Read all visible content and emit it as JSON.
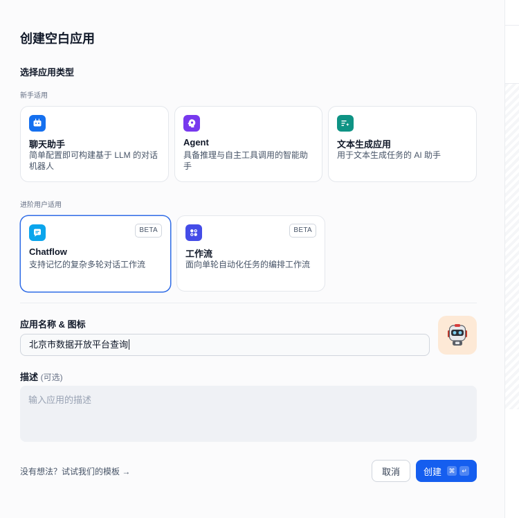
{
  "dialog": {
    "title": "创建空白应用",
    "app_type_title": "选择应用类型",
    "beginner_label": "新手适用",
    "advanced_label": "进阶用户适用"
  },
  "app_types": {
    "beginner": [
      {
        "name": "聊天助手",
        "desc": "简单配置即可构建基于 LLM 的对话机器人",
        "icon": "chat-bot-icon",
        "color": "#1570ef"
      },
      {
        "name": "Agent",
        "desc": "具备推理与自主工具调用的智能助手",
        "icon": "agent-brain-icon",
        "color": "#7839ee"
      },
      {
        "name": "文本生成应用",
        "desc": "用于文本生成任务的 AI 助手",
        "icon": "text-generation-icon",
        "color": "#0e9384"
      }
    ],
    "advanced": [
      {
        "name": "Chatflow",
        "desc": "支持记忆的复杂多轮对话工作流",
        "badge": "BETA",
        "icon": "chatflow-icon",
        "color": "#0ba5ec",
        "selected": true
      },
      {
        "name": "工作流",
        "desc": "面向单轮自动化任务的编排工作流",
        "badge": "BETA",
        "icon": "workflow-icon",
        "color": "#444ce7",
        "selected": false
      }
    ]
  },
  "name_field": {
    "label": "应用名称 & 图标",
    "value": "北京市数据开放平台查询",
    "avatar_icon": "robot-icon"
  },
  "description_field": {
    "label": "描述",
    "optional": "(可选)",
    "placeholder": "输入应用的描述"
  },
  "footer": {
    "template_link": "没有想法？试试我们的模板",
    "arrow": "→",
    "cancel": "取消",
    "create": "创建",
    "shortcut_cmd": "⌘",
    "shortcut_enter": "↵"
  },
  "colors": {
    "primary": "#155eef",
    "selected_border": "#2e6be6",
    "avatar_bg": "#fde9d6"
  }
}
